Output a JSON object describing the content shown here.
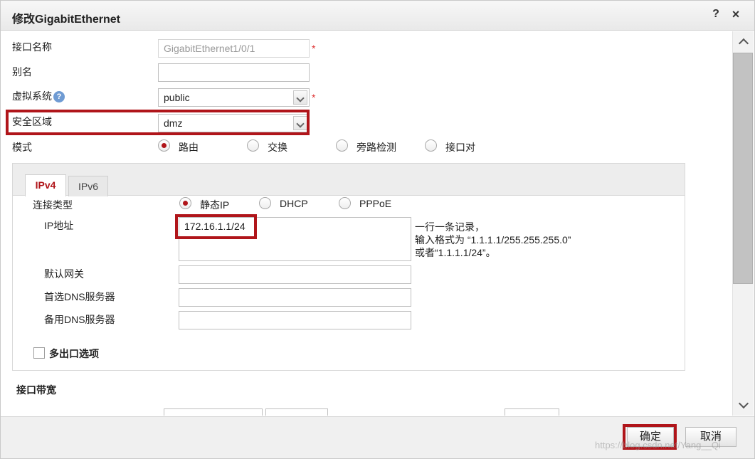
{
  "dialog": {
    "title": "修改GigabitEthernet",
    "help_icon": "?",
    "close_icon": "×"
  },
  "form": {
    "interface_name_label": "接口名称",
    "interface_name_value": "GigabitEthernet1/0/1",
    "required_mark": "*",
    "alias_label": "别名",
    "alias_value": "",
    "vsys_label": "虚拟系统",
    "vsys_help": "?",
    "vsys_value": "public",
    "zone_label": "安全区域",
    "zone_value": "dmz",
    "mode_label": "模式",
    "mode_options": [
      "路由",
      "交换",
      "旁路检测",
      "接口对"
    ],
    "mode_selected": "路由"
  },
  "ip_panel": {
    "tabs": [
      "IPv4",
      "IPv6"
    ],
    "active_tab": "IPv4",
    "conn_type_label": "连接类型",
    "conn_type_options": [
      "静态IP",
      "DHCP",
      "PPPoE"
    ],
    "conn_type_selected": "静态IP",
    "ip_label": "IP地址",
    "ip_value": "172.16.1.1/24",
    "ip_hint_1": "一行一条记录，",
    "ip_hint_2": "输入格式为 “1.1.1.1/255.255.255.0”",
    "ip_hint_3": "或者“1.1.1.1/24”。",
    "gateway_label": "默认网关",
    "gateway_value": "",
    "dns1_label": "首选DNS服务器",
    "dns1_value": "",
    "dns2_label": "备用DNS服务器",
    "dns2_value": "",
    "multi_exit_label": "多出口选项"
  },
  "bandwidth": {
    "section_label": "接口带宽"
  },
  "footer": {
    "ok_label": "确定",
    "cancel_label": "取消"
  },
  "watermark": "https://blog.csdn.net/Yang__Qi",
  "colors": {
    "accent_red": "#b0151a",
    "help_blue": "#6f9bd3"
  }
}
